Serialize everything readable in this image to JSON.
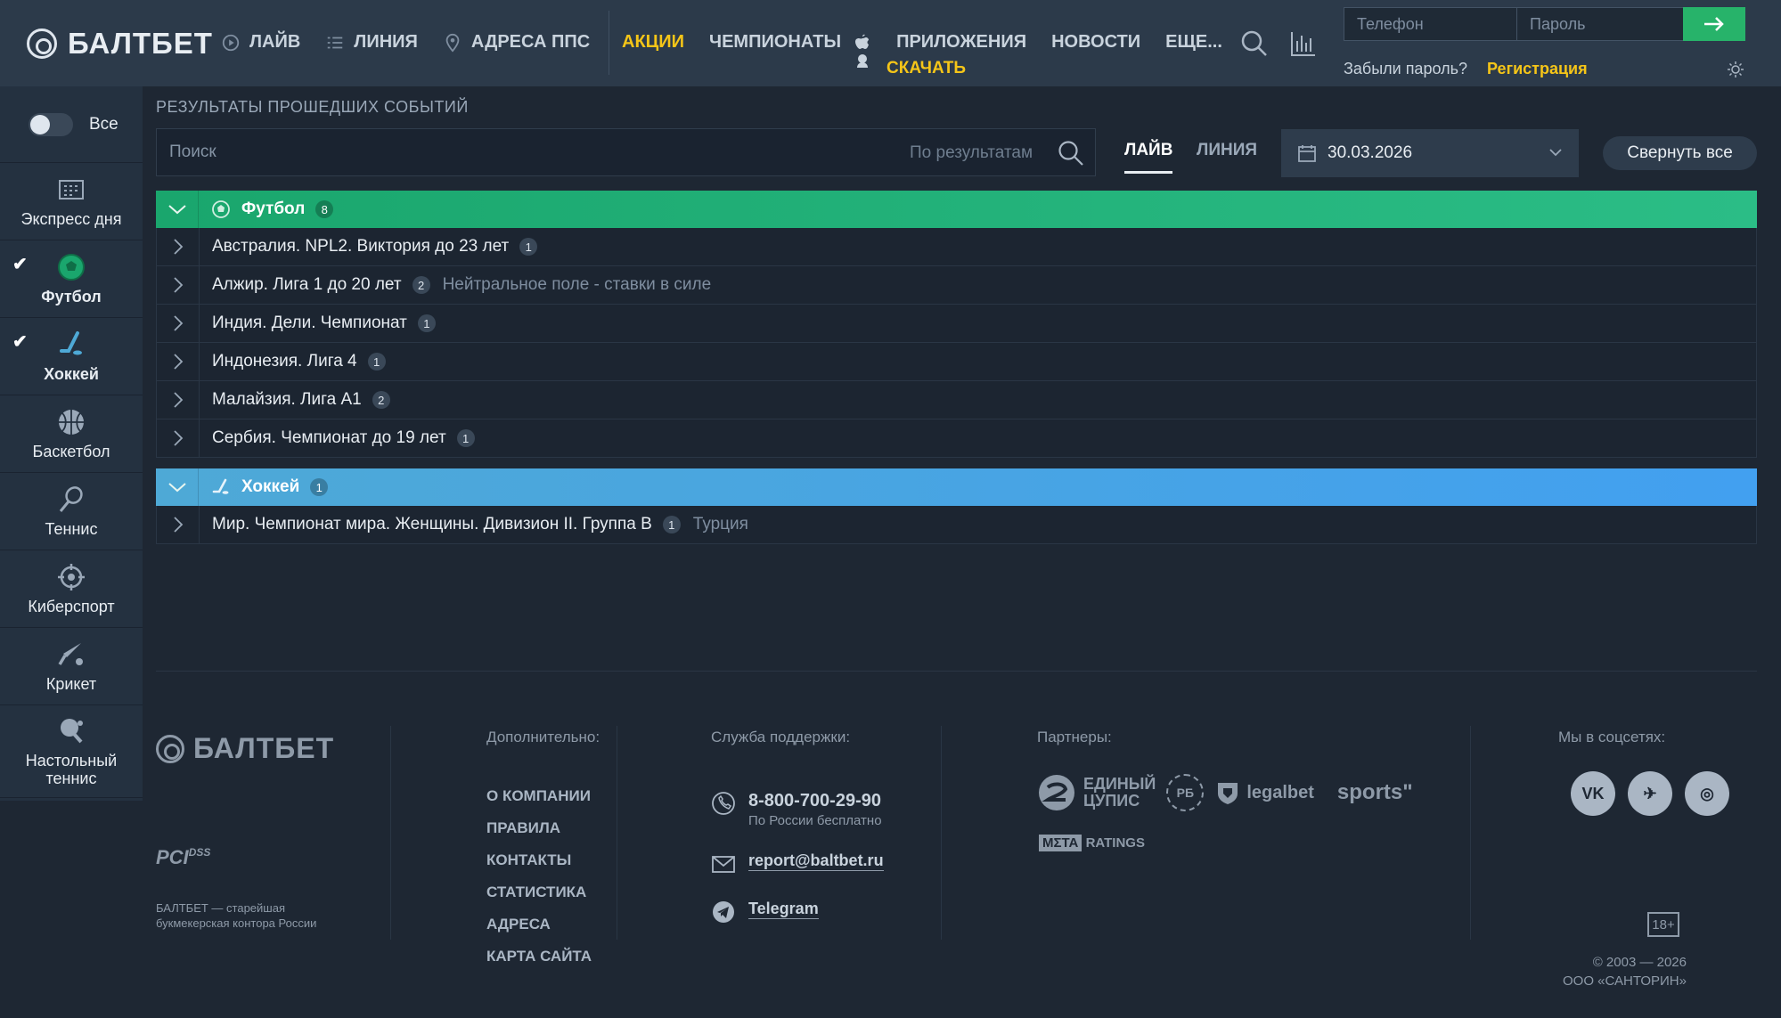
{
  "header": {
    "logo": "БАЛТБЕТ",
    "nav": [
      {
        "label": "ЛАЙВ",
        "icon": "live-icon"
      },
      {
        "label": "ЛИНИЯ",
        "icon": "list-icon"
      },
      {
        "label": "АДРЕСА ППС",
        "icon": "location-pin-icon"
      }
    ],
    "nav2": {
      "promo": "АКЦИИ",
      "championships": "ЧЕМПИОНАТЫ",
      "apps": "ПРИЛОЖЕНИЯ",
      "download": "СКАЧАТЬ",
      "news": "НОВОСТИ",
      "more": "ЕЩЕ..."
    },
    "phone_placeholder": "Телефон",
    "password_placeholder": "Пароль",
    "forgot": "Забыли пароль?",
    "register": "Регистрация",
    "accent": "#27b36a",
    "highlight": "#f5c518"
  },
  "sidebar": {
    "toggle_label": "Все",
    "items": [
      {
        "label": "Экспресс дня",
        "icon": "calendar-grid-icon",
        "checked": false
      },
      {
        "label": "Футбол",
        "icon": "soccer-ball-icon",
        "checked": true
      },
      {
        "label": "Хоккей",
        "icon": "hockey-stick-icon",
        "checked": true
      },
      {
        "label": "Баскетбол",
        "icon": "basketball-icon",
        "checked": false
      },
      {
        "label": "Теннис",
        "icon": "tennis-racket-icon",
        "checked": false
      },
      {
        "label": "Киберспорт",
        "icon": "crosshair-icon",
        "checked": false
      },
      {
        "label": "Крикет",
        "icon": "cricket-bat-icon",
        "checked": false
      },
      {
        "label": "Настольный теннис",
        "icon": "table-tennis-icon",
        "checked": false
      }
    ]
  },
  "main": {
    "title": "РЕЗУЛЬТАТЫ ПРОШЕДШИХ СОБЫТИЙ",
    "search_placeholder": "Поиск",
    "search_scope": "По результатам",
    "tabs": {
      "live": "ЛАЙВ",
      "line": "ЛИНИЯ"
    },
    "date": "30.03.2026",
    "collapse_all": "Свернуть все",
    "groups": [
      {
        "name": "Футбол",
        "count": "8",
        "rows": [
          {
            "name": "Австралия. NPL2. Виктория до 23 лет",
            "count": "1",
            "note": ""
          },
          {
            "name": "Алжир. Лига 1 до 20 лет",
            "count": "2",
            "note": "Нейтральное поле - ставки в силе"
          },
          {
            "name": "Индия. Дели. Чемпионат",
            "count": "1",
            "note": ""
          },
          {
            "name": "Индонезия. Лига 4",
            "count": "1",
            "note": ""
          },
          {
            "name": "Малайзия. Лига А1",
            "count": "2",
            "note": ""
          },
          {
            "name": "Сербия. Чемпионат до 19 лет",
            "count": "1",
            "note": ""
          }
        ]
      },
      {
        "name": "Хоккей",
        "count": "1",
        "rows": [
          {
            "name": "Мир. Чемпионат мира. Женщины. Дивизион II. Группа B",
            "count": "1",
            "note": "Турция"
          }
        ]
      }
    ]
  },
  "footer": {
    "logo": "БАЛТБЕТ",
    "pci": "PCI",
    "pci_sup": "DSS",
    "tagline": "БАЛТБЕТ — старейшая букмекерская контора России",
    "extra_head": "Дополнительно:",
    "links": [
      "О КОМПАНИИ",
      "ПРАВИЛА",
      "КОНТАКТЫ",
      "СТАТИСТИКА",
      "АДРЕСА",
      "КАРТА САЙТА"
    ],
    "support_head": "Служба поддержки:",
    "phone": "8-800-700-29-90",
    "phone_note": "По России бесплатно",
    "email": "report@baltbet.ru",
    "telegram": "Telegram",
    "partners_head": "Партнеры:",
    "partner_cups_1": "ЕДИНЫЙ",
    "partner_cups_2": "ЦУПИС",
    "partner_rb": "РБ",
    "partner_legalbet": "legalbet",
    "partner_sports": "sports\"",
    "partner_meta_1": "MΣTA",
    "partner_meta_2": "RATINGS",
    "social_head": "Мы в соцсетях:",
    "social": [
      "VK",
      "✈",
      "◎"
    ],
    "age": "18+",
    "copyright_1": "© 2003 — 2026",
    "copyright_2": "ООО «САНТОРИН»"
  }
}
